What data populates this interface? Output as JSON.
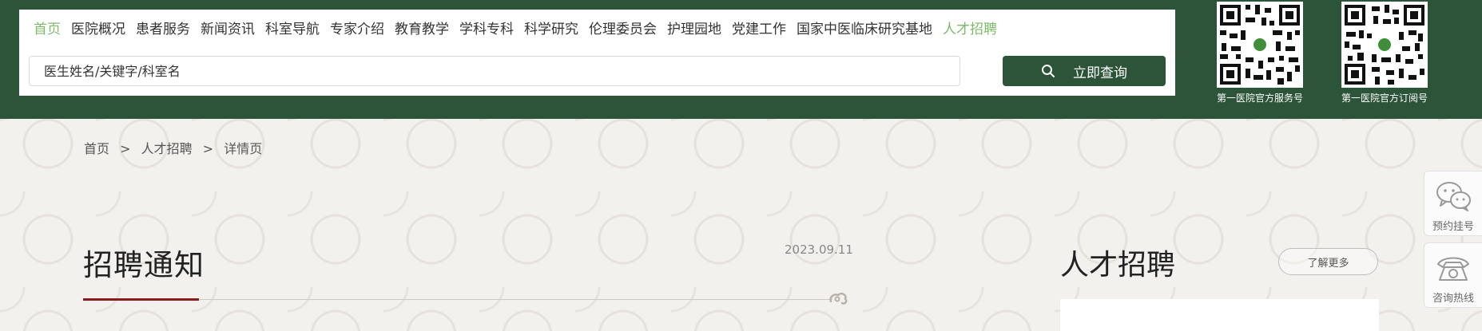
{
  "nav": {
    "items": [
      {
        "label": "首页"
      },
      {
        "label": "医院概况"
      },
      {
        "label": "患者服务"
      },
      {
        "label": "新闻资讯"
      },
      {
        "label": "科室导航"
      },
      {
        "label": "专家介绍"
      },
      {
        "label": "教育教学"
      },
      {
        "label": "学科专科"
      },
      {
        "label": "科学研究"
      },
      {
        "label": "伦理委员会"
      },
      {
        "label": "护理园地"
      },
      {
        "label": "党建工作"
      },
      {
        "label": "国家中医临床研究基地"
      },
      {
        "label": "人才招聘"
      }
    ]
  },
  "search": {
    "placeholder": "医生姓名/关键字/科室名",
    "button_label": "立即查询"
  },
  "qr_codes": [
    {
      "caption": "第一医院官方服务号"
    },
    {
      "caption": "第一医院官方订阅号"
    }
  ],
  "breadcrumb": {
    "home": "首页",
    "sep": ">",
    "section": "人才招聘",
    "current": "详情页"
  },
  "article": {
    "title": "招聘通知",
    "date": "2023.09.11"
  },
  "sidebar": {
    "title": "人才招聘",
    "more_label": "了解更多"
  },
  "float_bar": {
    "items": [
      {
        "label": "预约挂号",
        "icon": "wechat-icon"
      },
      {
        "label": "咨询热线",
        "icon": "phone-icon"
      }
    ]
  },
  "colors": {
    "brand_green": "#2c5438",
    "accent_green": "#7cbb6a",
    "accent_red": "#8b1c1c"
  }
}
